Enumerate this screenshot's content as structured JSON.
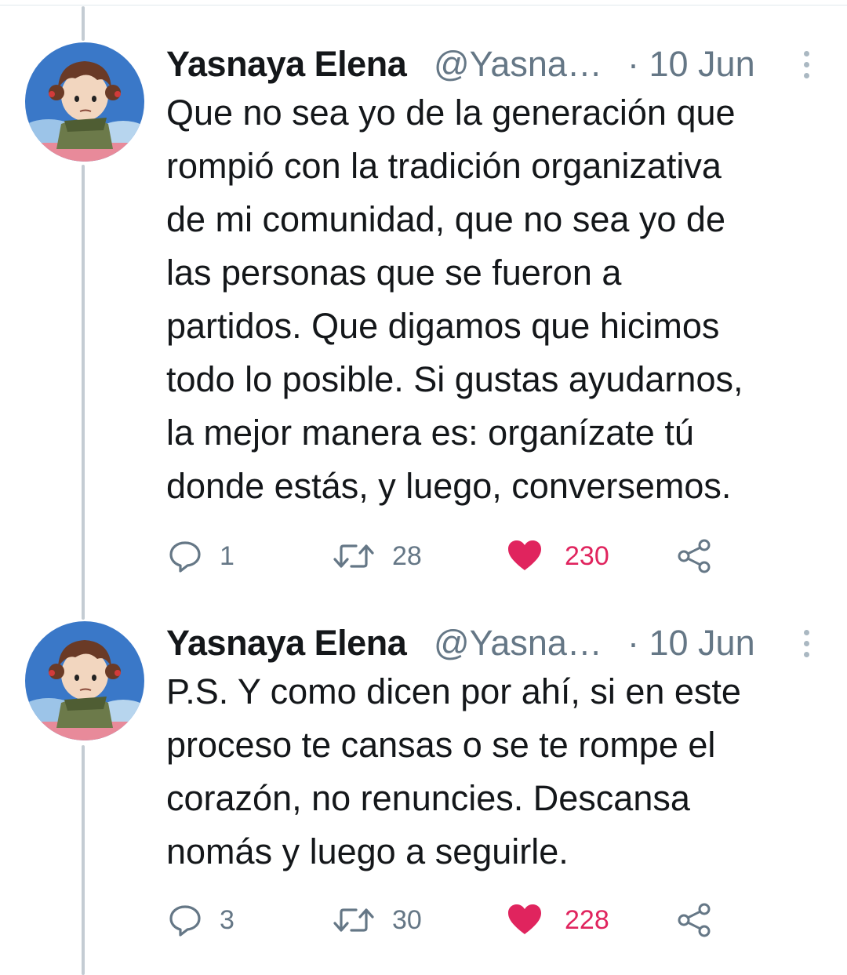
{
  "tweets": [
    {
      "author": {
        "name": "Yasnaya Elena",
        "handle": "@Yasna…"
      },
      "date": "· 10 Jun",
      "text": "Que no sea yo de la generación que\nrompió con la tradición organizativa\nde mi comunidad, que no sea yo de\nlas  personas que se fueron a\npartidos. Que digamos que hicimos\ntodo lo posible. Si gustas ayudarnos,\nla mejor manera es: organízate tú\ndonde estás, y luego, conversemos.",
      "stats": {
        "replies": "1",
        "retweets": "28",
        "likes": "230"
      },
      "liked": true
    },
    {
      "author": {
        "name": "Yasnaya Elena",
        "handle": "@Yasna…"
      },
      "date": "· 10 Jun",
      "text": "P.S. Y como dicen por ahí, si en este\nproceso te cansas o se te rompe el\ncorazón, no renuncies. Descansa\nnomás y luego a seguirle.",
      "stats": {
        "replies": "3",
        "retweets": "30",
        "likes": "228"
      },
      "liked": true
    }
  ],
  "colors": {
    "like": "#e0245e",
    "muted": "#657786",
    "thread_line": "#c4ccd3"
  },
  "icons": [
    "reply-icon",
    "retweet-icon",
    "heart-icon",
    "share-icon",
    "more-icon"
  ]
}
